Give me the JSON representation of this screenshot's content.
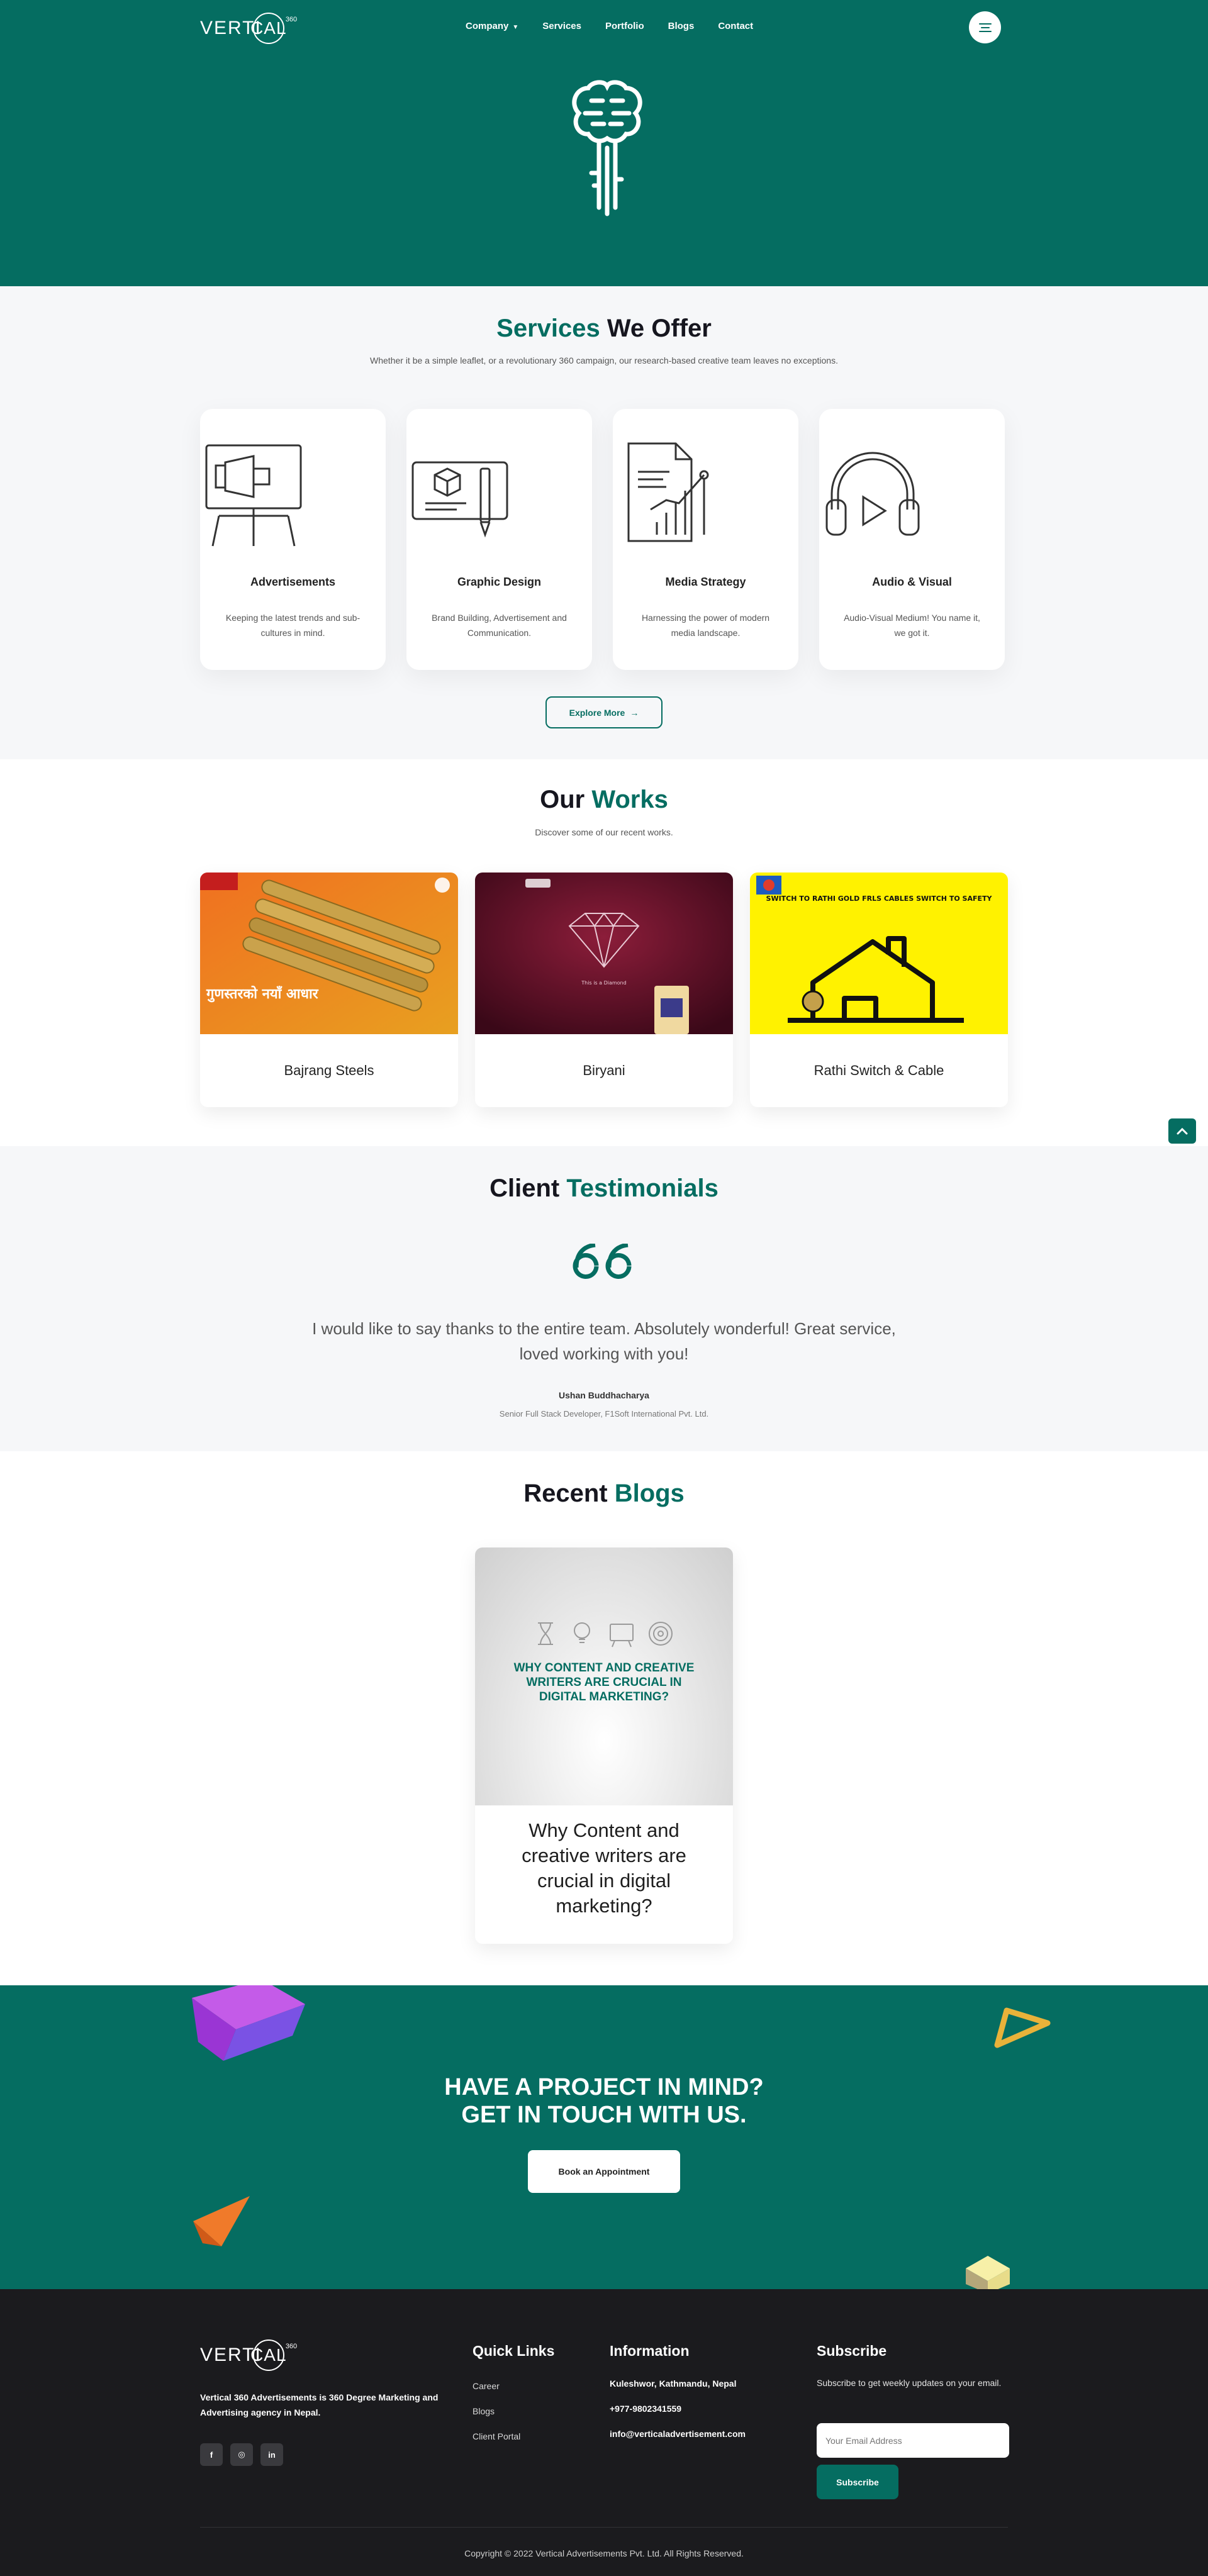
{
  "brand": {
    "logo_text": "VERTICAL",
    "logo_left": "VERTI",
    "logo_circle": "CAL",
    "logo_sup": "360"
  },
  "nav": {
    "items": [
      {
        "label": "Company",
        "has_dropdown": true
      },
      {
        "label": "Services"
      },
      {
        "label": "Portfolio"
      },
      {
        "label": "Blogs"
      },
      {
        "label": "Contact"
      }
    ]
  },
  "colors": {
    "primary": "#056d61",
    "footer_bg": "#1b1b1e",
    "section_bg": "#f6f7f9"
  },
  "services": {
    "title_accent": "Services",
    "title_rest": " We Offer",
    "subtitle": "Whether it be a simple leaflet, or a revolutionary 360 campaign, our research-based creative team leaves no exceptions.",
    "cards": [
      {
        "icon": "megaphone-board-icon",
        "title": "Advertisements",
        "desc": "Keeping the latest trends and sub-cultures in mind."
      },
      {
        "icon": "design-board-icon",
        "title": "Graphic Design",
        "desc": "Brand Building, Advertisement and Communication."
      },
      {
        "icon": "document-chart-icon",
        "title": "Media Strategy",
        "desc": "Harnessing the power of modern media landscape."
      },
      {
        "icon": "headphones-play-icon",
        "title": "Audio & Visual",
        "desc": "Audio-Visual Medium! You name it, we got it."
      }
    ],
    "explore_label": "Explore More"
  },
  "works": {
    "title_rest": "Our ",
    "title_accent": "Works",
    "subtitle": "Discover some of our recent works.",
    "items": [
      {
        "title": "Bajrang Steels",
        "image_text": "गुणस्तरको नयाँ आधार"
      },
      {
        "title": "Biryani",
        "image_text": "This is a Diamond"
      },
      {
        "title": "Rathi Switch & Cable",
        "image_text": "SWITCH TO RATHI GOLD FRLS CABLES SWITCH TO SAFETY"
      }
    ]
  },
  "testimonials": {
    "title_rest": "Client ",
    "title_accent": "Testimonials",
    "quote": "I would like to say thanks to the entire team. Absolutely wonderful! Great service, loved working with you!",
    "name": "Ushan Buddhacharya",
    "role": "Senior Full Stack Developer, F1Soft International Pvt. Ltd."
  },
  "blogs": {
    "title_rest": "Recent ",
    "title_accent": "Blogs",
    "items": [
      {
        "image_title": "WHY CONTENT AND CREATIVE WRITERS ARE CRUCIAL IN DIGITAL MARKETING?",
        "title": "Why Content and creative writers are crucial in digital marketing?"
      }
    ]
  },
  "cta": {
    "line1": "HAVE A PROJECT IN MIND?",
    "line2": "GET IN TOUCH WITH US.",
    "button": "Book an Appointment"
  },
  "footer": {
    "about": "Vertical 360 Advertisements is 360 Degree Marketing and Advertising agency in Nepal.",
    "socials": [
      {
        "icon": "facebook-icon",
        "glyph": "f"
      },
      {
        "icon": "instagram-icon",
        "glyph": "◎"
      },
      {
        "icon": "linkedin-icon",
        "glyph": "in"
      }
    ],
    "quick_links_title": "Quick Links",
    "quick_links": [
      "Career",
      "Blogs",
      "Client Portal"
    ],
    "info_title": "Information",
    "info": [
      "Kuleshwor, Kathmandu, Nepal",
      "+977-9802341559",
      "info@verticaladvertisement.com"
    ],
    "subscribe_title": "Subscribe",
    "subscribe_desc": "Subscribe to get weekly updates on your email.",
    "email_placeholder": "Your Email Address",
    "subscribe_button": "Subscribe",
    "copyright": "Copyright © 2022 Vertical Advertisements Pvt. Ltd. All Rights Reserved."
  }
}
